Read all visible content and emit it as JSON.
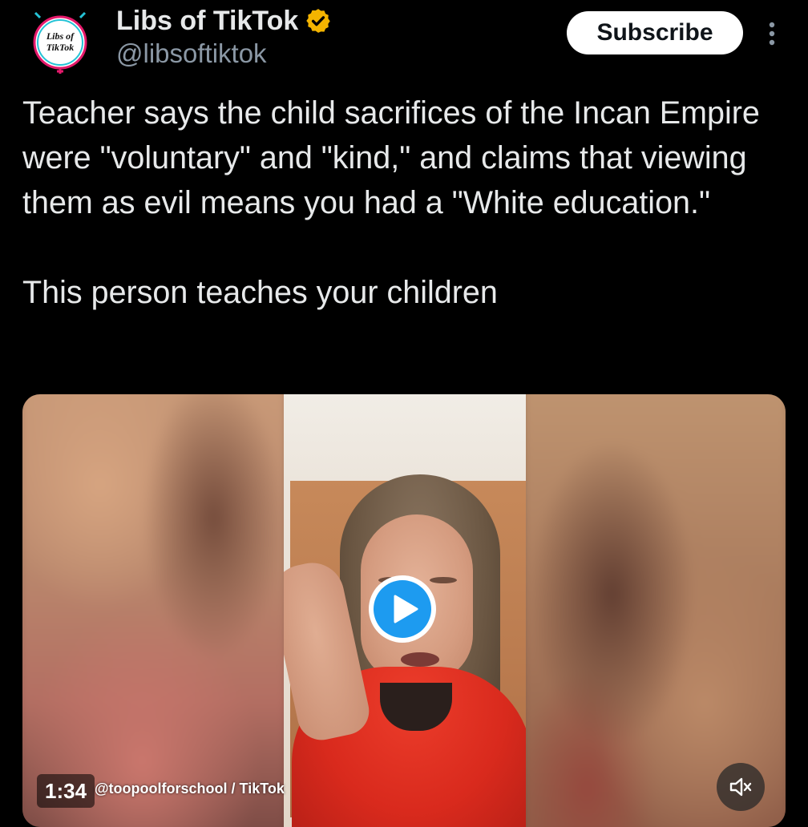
{
  "author": {
    "display_name": "Libs of TikTok",
    "handle": "@libsoftiktok",
    "verified": true,
    "verified_color": "#f4b400",
    "avatar_icon": "libs-of-tiktok-logo",
    "avatar_logo_text_line1": "Libs of",
    "avatar_logo_text_line2": "TikTok"
  },
  "actions": {
    "subscribe_label": "Subscribe",
    "more_icon": "more-vertical-icon"
  },
  "tweet": {
    "paragraph1": "Teacher says the child sacrifices of the Incan Empire were \"voluntary\" and \"kind,\" and claims that viewing them as evil means you had a \"White education.\"",
    "paragraph2": "This person teaches your children"
  },
  "video": {
    "duration": "1:34",
    "watermark": "@toopoolforschool / TikTok",
    "play_icon": "play-icon",
    "mute_icon": "muted-speaker-icon",
    "accent_color": "#1d9bf0"
  }
}
